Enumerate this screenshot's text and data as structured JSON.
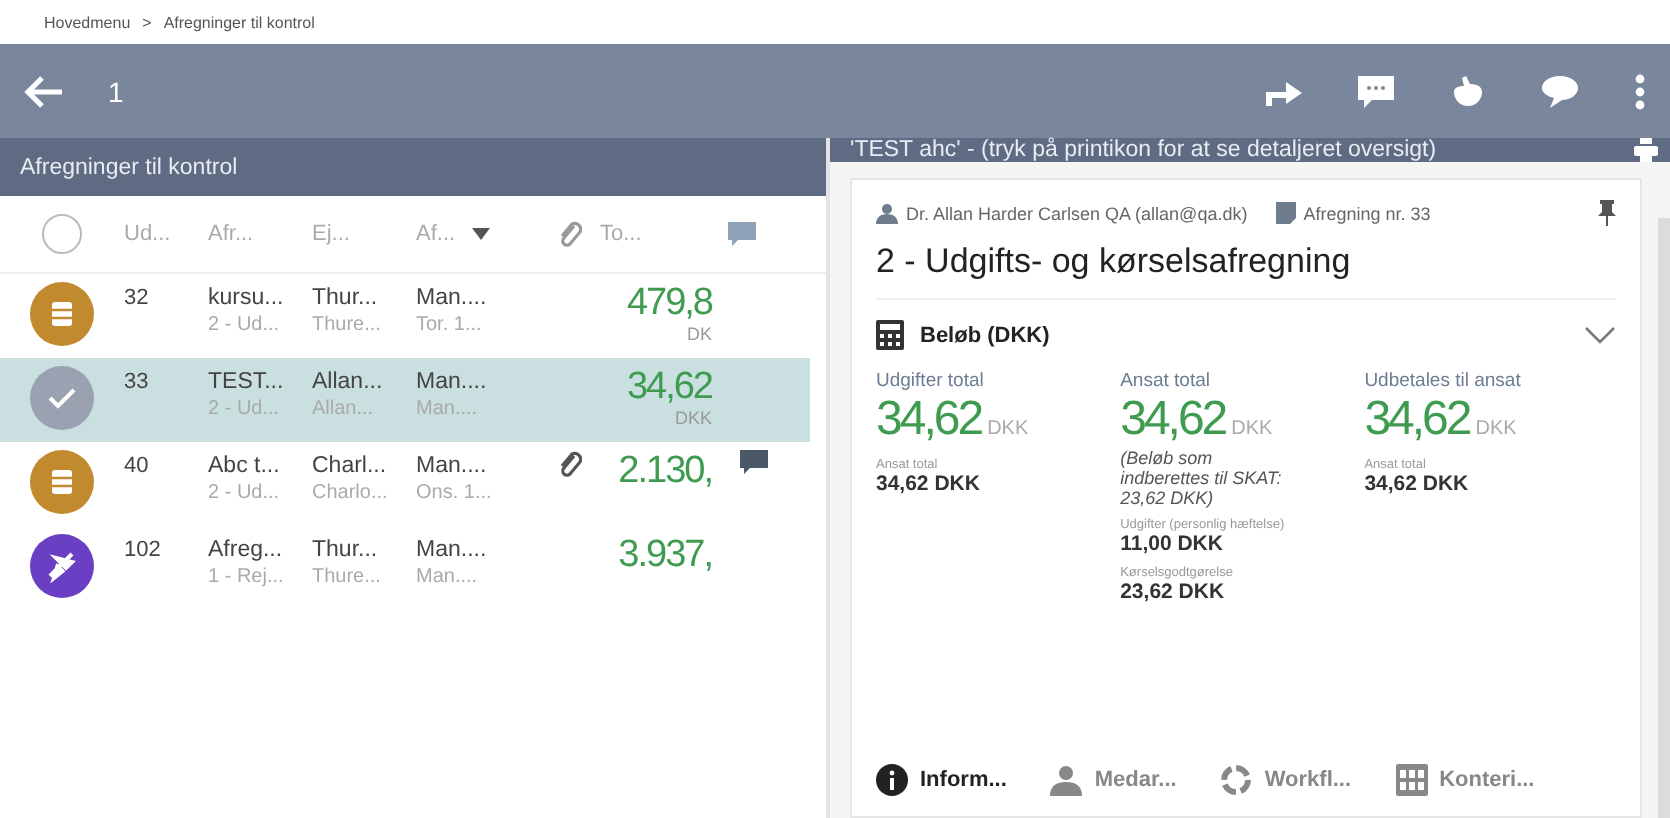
{
  "breadcrumb": [
    "Hovedmenu",
    ">",
    "Afregninger til kontrol"
  ],
  "toolbar": {
    "count": "1"
  },
  "list_panel": {
    "title": "Afregninger til kontrol",
    "select_all": {
      "checked": false
    },
    "columns": [
      {
        "label": "Ud...",
        "sorted": false
      },
      {
        "label": "Afr...",
        "sorted": false
      },
      {
        "label": "Ej...",
        "sorted": false
      },
      {
        "label": "Af...",
        "sorted": true
      },
      {
        "label": "To...",
        "sorted": false
      }
    ],
    "rows": [
      {
        "kind": "receipt",
        "selected": false,
        "number": "32",
        "line1": [
          "kursu...",
          "Thur...",
          "Man...."
        ],
        "line2": [
          "2 - Ud...",
          "Thure...",
          "Tor. 1..."
        ],
        "attachment": false,
        "comment": false,
        "amount": "479,8",
        "currency": "DK"
      },
      {
        "kind": "checked",
        "selected": true,
        "number": "33",
        "line1": [
          "TEST...",
          "Allan...",
          "Man...."
        ],
        "line2": [
          "2 - Ud...",
          "Allan...",
          "Man...."
        ],
        "attachment": false,
        "comment": false,
        "amount": "34,62",
        "currency": "DKK"
      },
      {
        "kind": "receipt",
        "selected": false,
        "number": "40",
        "line1": [
          "Abc t...",
          "Charl...",
          "Man...."
        ],
        "line2": [
          "2 - Ud...",
          "Charlo...",
          "Ons. 1..."
        ],
        "attachment": true,
        "comment": true,
        "amount": "2.130,"
      },
      {
        "kind": "plane",
        "selected": false,
        "number": "102",
        "line1": [
          "Afreg...",
          "Thur...",
          "Man...."
        ],
        "line2": [
          "1 - Rej...",
          "Thure...",
          "Man...."
        ],
        "attachment": false,
        "comment": false,
        "amount": "3.937,"
      }
    ]
  },
  "detail_panel": {
    "title": "'TEST ahc' - (tryk på printikon for at se detaljeret oversigt)",
    "person": "Dr. Allan Harder Carlsen QA (allan@qa.dk)",
    "document": "Afregning nr. 33",
    "heading": "2 - Udgifts- og kørselsafregning",
    "section": {
      "title": "Beløb (DKK)",
      "expanded": true
    },
    "totals": [
      {
        "label": "Udgifter total",
        "amount": "34,62",
        "currency": "DKK",
        "details": [
          {
            "label": "Ansat total",
            "value": "34,62 DKK"
          }
        ]
      },
      {
        "label": "Ansat total",
        "amount": "34,62",
        "currency": "DKK",
        "note": "(Beløb som indberettes til SKAT: 23,62 DKK)",
        "details": [
          {
            "label": "Udgifter (personlig hæftelse)",
            "value": "11,00 DKK"
          },
          {
            "label": "Kørselsgodtgørelse",
            "value": "23,62 DKK"
          }
        ]
      },
      {
        "label": "Udbetales til ansat",
        "amount": "34,62",
        "currency": "DKK",
        "details": [
          {
            "label": "Ansat total",
            "value": "34,62 DKK"
          }
        ]
      }
    ],
    "tabs": [
      {
        "kind": "info",
        "label": "Inform...",
        "selected": true
      },
      {
        "kind": "person",
        "label": "Medar...",
        "selected": false
      },
      {
        "kind": "workflow",
        "label": "Workfl...",
        "selected": false
      },
      {
        "kind": "grid",
        "label": "Konteri...",
        "selected": false
      }
    ]
  }
}
